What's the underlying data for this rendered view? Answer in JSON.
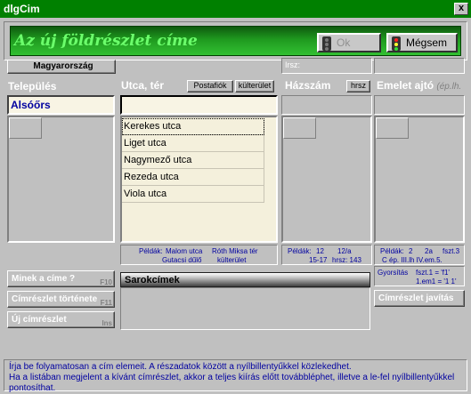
{
  "window": {
    "title": "dlgCim",
    "close_label": "x"
  },
  "banner": {
    "title": "Az új földrészlet címe",
    "ok_label": "Ok",
    "cancel_label": "Mégsem"
  },
  "country_button": "Magyarország",
  "irsz_label": "Irsz:",
  "settlement": {
    "label": "Település",
    "value": "Alsóőrs"
  },
  "street": {
    "label": "Utca, tér",
    "postafiok_button": "Postafiók",
    "kulterulet_button": "külterület",
    "value": "",
    "items": [
      "Kerekes utca",
      "Liget utca",
      "Nagymező utca",
      "Rezeda utca",
      "Viola utca"
    ],
    "examples": {
      "label": "Példák:",
      "ex1": "Malom utca",
      "ex2": "Róth Miksa tér",
      "ex3": "Gutacsi dűlő",
      "ex4": "külterület"
    }
  },
  "house": {
    "label": "Házszám",
    "hrsz_button": "hrsz",
    "examples": {
      "label": "Példák:",
      "ex1": "12",
      "ex2": "12/a",
      "ex3": "15-17",
      "ex4": "hrsz: 143"
    }
  },
  "floor": {
    "label": "Emelet ajtó",
    "sublabel": "(ép.lh.",
    "examples": {
      "label": "Példák:",
      "ex1": "2",
      "ex2": "2a",
      "ex3": "fszt.3",
      "ex4": "C ép. III.lh IV.em.5."
    },
    "shortcuts": {
      "label": "Gyorsítás",
      "s1": "fszt.1 = 'f1'",
      "s2": "1.em1 = '1 1'"
    },
    "fix_button": "Címrészlet javítás"
  },
  "left_buttons": [
    {
      "label": "Minek a címe ?",
      "key": "F10"
    },
    {
      "label": "Címrészlet története",
      "key": "F11"
    },
    {
      "label": "Új címrészlet",
      "key": "Ins"
    }
  ],
  "corner": {
    "label": "Sarokcímek"
  },
  "help_text": "Írja be folyamatosan a cím elemeit. A részadatok között a nyílbillentyűkkel közlekedhet.\nHa a listában megjelent a kívánt címrészlet, akkor a teljes kiírás előtt továbbléphet, illetve a le-fel nyílbillentyűkkel pontosíthat.",
  "colors": {
    "title_bar": "#008000",
    "banner_text": "#6cff6c",
    "settlement_text": "#0000a0",
    "examples_text": "#0000a0"
  }
}
